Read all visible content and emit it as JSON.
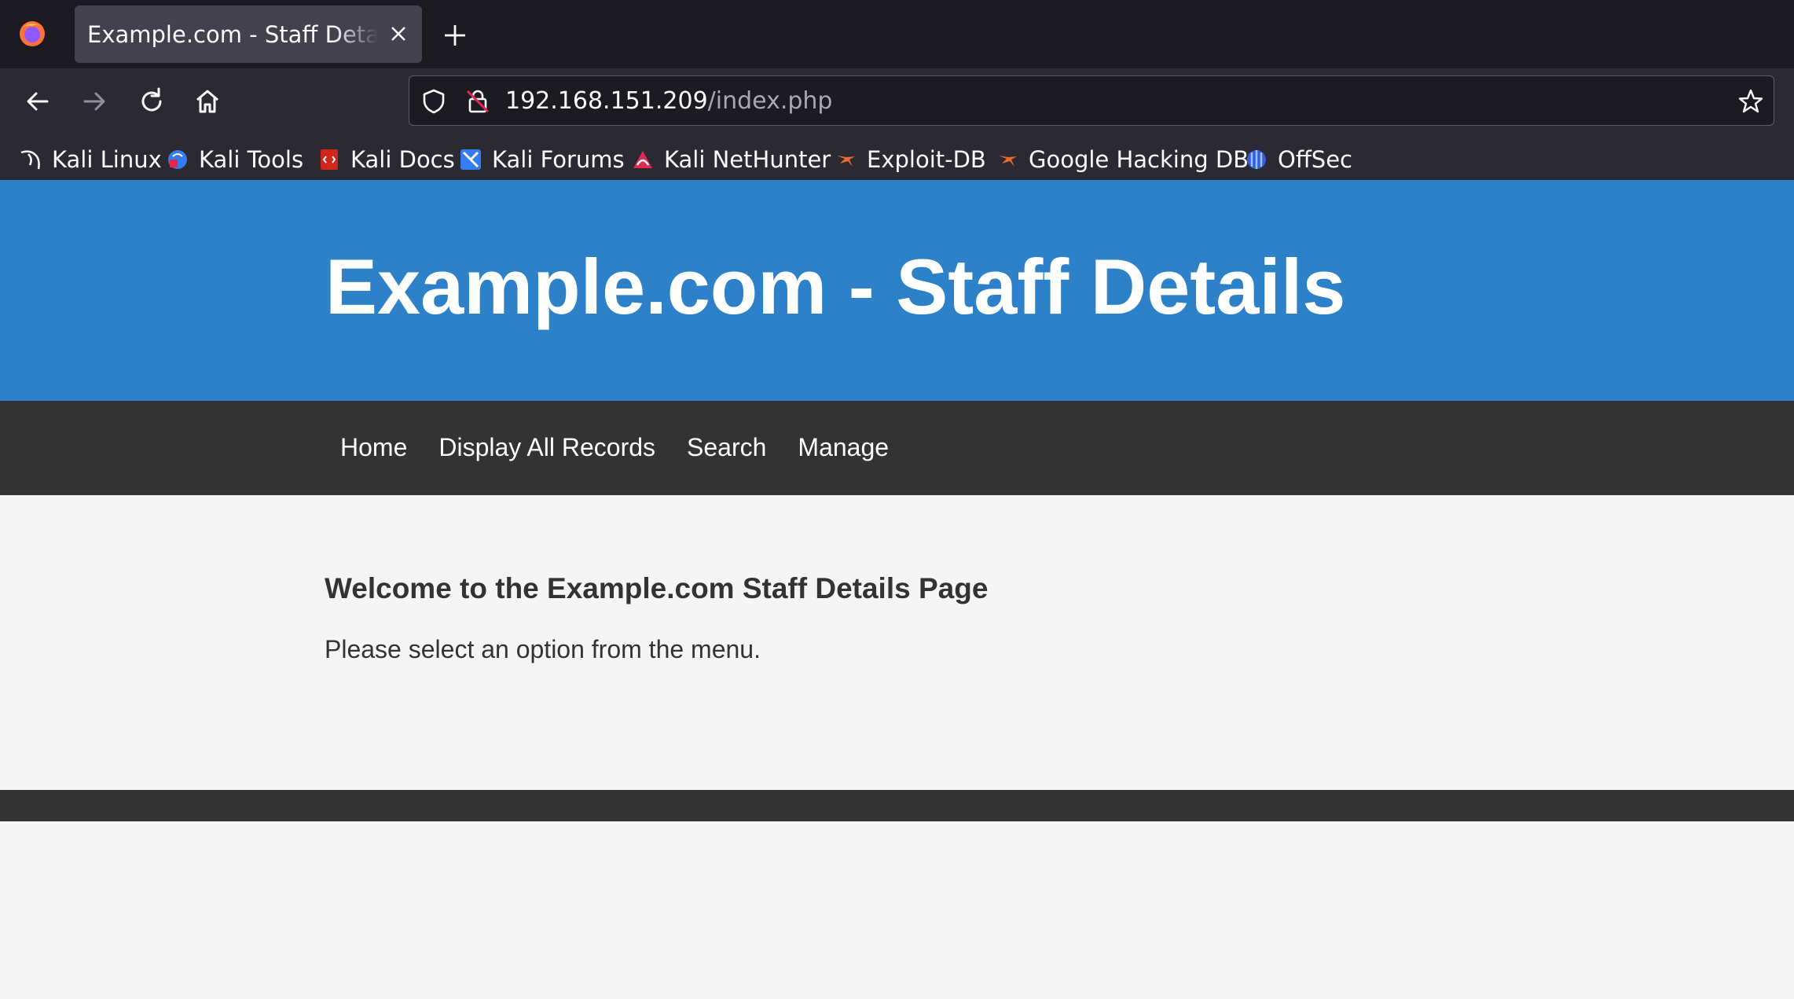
{
  "browser": {
    "tab_title": "Example.com - Staff Details - Mozilla Firefox",
    "url_host": "192.168.151.209",
    "url_path": "/index.php",
    "bookmarks": [
      {
        "label": "Kali Linux",
        "icon": "kali-dragon-icon"
      },
      {
        "label": "Kali Tools",
        "icon": "kali-tools-icon"
      },
      {
        "label": "Kali Docs",
        "icon": "kali-docs-icon"
      },
      {
        "label": "Kali Forums",
        "icon": "kali-forums-icon"
      },
      {
        "label": "Kali NetHunter",
        "icon": "nethunter-icon"
      },
      {
        "label": "Exploit-DB",
        "icon": "exploit-db-icon"
      },
      {
        "label": "Google Hacking DB",
        "icon": "ghdb-icon"
      },
      {
        "label": "OffSec",
        "icon": "offsec-icon"
      }
    ]
  },
  "site": {
    "title": "Example.com - Staff Details",
    "nav": [
      "Home",
      "Display All Records",
      "Search",
      "Manage"
    ],
    "heading": "Welcome to the Example.com Staff Details Page",
    "message": "Please select an option from the menu."
  },
  "colors": {
    "header_blue": "#2c81c9",
    "nav_dark": "#333333",
    "page_bg": "#f5f5f5",
    "browser_dark": "#1c1b22"
  }
}
